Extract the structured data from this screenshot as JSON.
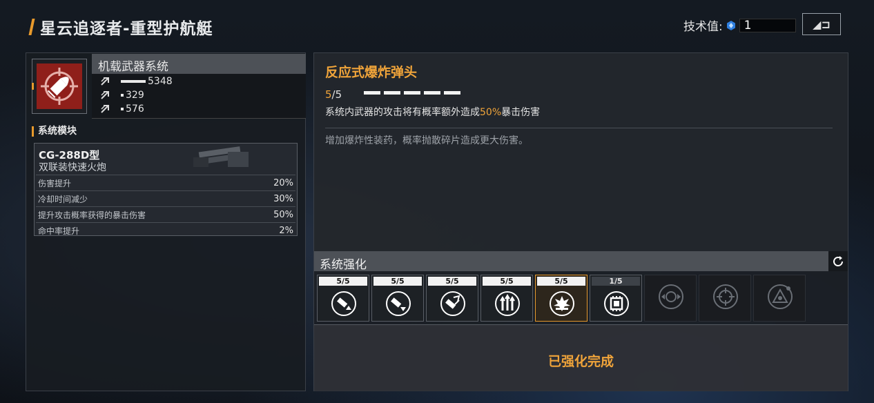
{
  "header": {
    "title": "星云追逐者-重型护航艇",
    "tech_label": "技术值:",
    "tech_value": "1",
    "back_label": "◢⊐"
  },
  "weapon_system": {
    "title": "机载武器系统",
    "stats": [
      {
        "icon": "upgrade-arrow-icon",
        "value": "5348",
        "level": 0.6
      },
      {
        "icon": "upgrade-arrow-icon",
        "value": "329",
        "level": 0.15
      },
      {
        "icon": "upgrade-arrow-icon",
        "value": "576",
        "level": 0.15
      }
    ]
  },
  "module": {
    "section_label": "系统模块",
    "name": "CG-288D型",
    "subtitle": "双联装快速火炮",
    "rows": [
      {
        "label": "伤害提升",
        "value": "20%"
      },
      {
        "label": "冷却时间减少",
        "value": "30%"
      },
      {
        "label": "提升攻击概率获得的暴击伤害",
        "value": "50%"
      },
      {
        "label": "命中率提升",
        "value": "2%"
      }
    ]
  },
  "perk": {
    "title": "反应式爆炸弹头",
    "level_current": "5",
    "level_sep_max": "/5",
    "desc_before": "系统内武器的攻击将有概率额外造成",
    "desc_highlight": "50%",
    "desc_after": "暴击伤害",
    "flavor": "增加爆炸性装药，概率抛散碎片造成更大伤害。"
  },
  "enhance": {
    "title": "系统强化",
    "slots": [
      {
        "count": "5/5",
        "icon": "damage-up-icon",
        "state": "maxed"
      },
      {
        "count": "5/5",
        "icon": "cooldown-down-icon",
        "state": "maxed"
      },
      {
        "count": "5/5",
        "icon": "crit-chance-icon",
        "state": "maxed"
      },
      {
        "count": "5/5",
        "icon": "triple-arrow-icon",
        "state": "maxed"
      },
      {
        "count": "5/5",
        "icon": "explosion-icon",
        "state": "selected"
      },
      {
        "count": "1/5",
        "icon": "chip-icon",
        "state": "partial"
      },
      {
        "icon": "target-arrows-icon",
        "state": "locked"
      },
      {
        "icon": "crosshair-icon",
        "state": "locked"
      },
      {
        "icon": "ship-shield-icon",
        "state": "locked"
      }
    ],
    "status": "已强化完成"
  },
  "colors": {
    "accent": "#f0a43a",
    "weapon_bg": "#8f1f1a"
  }
}
